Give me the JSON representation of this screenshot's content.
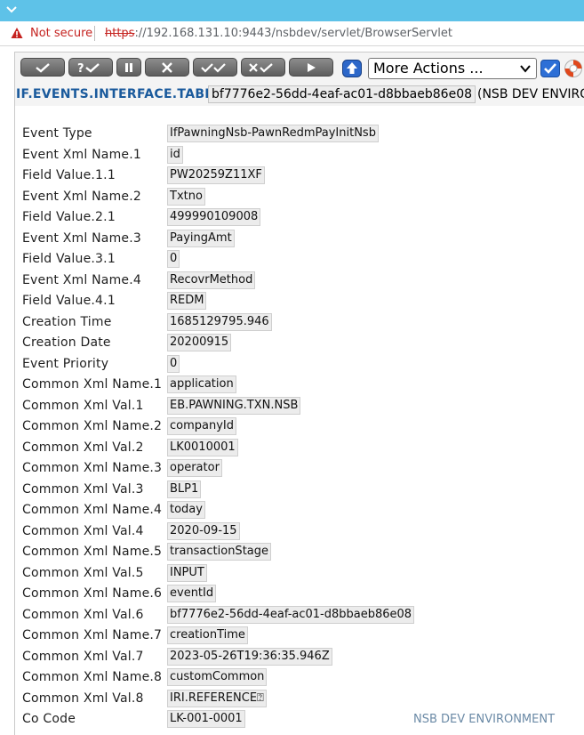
{
  "browser": {
    "security_label": "Not secure",
    "url_scheme": "https",
    "url_rest": "://192.168.131.10:9443/nsbdev/servlet/BrowserServlet"
  },
  "toolbar": {
    "buttons": [
      "commit-tick",
      "validate-tick",
      "hold",
      "delete",
      "authorise",
      "reverse",
      "next"
    ],
    "more_actions_label": "More Actions ..."
  },
  "header": {
    "table_name": "IF.EVENTS.INTERFACE.TABLE",
    "record_id": "bf7776e2-56dd-4eaf-ac01-d8bbaeb86e08",
    "environment": "(NSB DEV ENVIRO"
  },
  "fields": [
    {
      "label": "Event Type",
      "value": "IfPawningNsb-PawnRedmPayInitNsb"
    },
    {
      "label": "Event Xml Name.1",
      "value": "id"
    },
    {
      "label": "Field Value.1.1",
      "value": "PW20259Z11XF"
    },
    {
      "label": "Event Xml Name.2",
      "value": "Txtno"
    },
    {
      "label": "Field Value.2.1",
      "value": "499990109008"
    },
    {
      "label": "Event Xml Name.3",
      "value": "PayingAmt"
    },
    {
      "label": "Field Value.3.1",
      "value": "0"
    },
    {
      "label": "Event Xml Name.4",
      "value": "RecovrMethod"
    },
    {
      "label": "Field Value.4.1",
      "value": "REDM"
    },
    {
      "label": "Creation Time",
      "value": "1685129795.946"
    },
    {
      "label": "Creation Date",
      "value": "20200915"
    },
    {
      "label": "Event Priority",
      "value": "0"
    },
    {
      "label": "Common Xml Name.1",
      "value": "application"
    },
    {
      "label": "Common Xml Val.1",
      "value": "EB.PAWNING.TXN.NSB"
    },
    {
      "label": "Common Xml Name.2",
      "value": "companyId"
    },
    {
      "label": "Common Xml Val.2",
      "value": "LK0010001"
    },
    {
      "label": "Common Xml Name.3",
      "value": "operator"
    },
    {
      "label": "Common Xml Val.3",
      "value": "BLP1"
    },
    {
      "label": "Common Xml Name.4",
      "value": "today"
    },
    {
      "label": "Common Xml Val.4",
      "value": "2020-09-15"
    },
    {
      "label": "Common Xml Name.5",
      "value": "transactionStage"
    },
    {
      "label": "Common Xml Val.5",
      "value": "INPUT"
    },
    {
      "label": "Common Xml Name.6",
      "value": "eventId"
    },
    {
      "label": "Common Xml Val.6",
      "value": "bf7776e2-56dd-4eaf-ac01-d8bbaeb86e08"
    },
    {
      "label": "Common Xml Name.7",
      "value": "creationTime"
    },
    {
      "label": "Common Xml Val.7",
      "value": "2023-05-26T19:36:35.946Z"
    },
    {
      "label": "Common Xml Name.8",
      "value": "customCommon"
    },
    {
      "label": "Common Xml Val.8",
      "value": "IRI.REFERENCE⍰"
    },
    {
      "label": "Co Code",
      "value": "LK-001-0001"
    }
  ],
  "footer": {
    "environment": "NSB DEV ENVIRONMENT"
  },
  "colors": {
    "titlebar": "#5ec2e8",
    "link_blue": "#1a5a9c",
    "warning_red": "#c5221f"
  }
}
